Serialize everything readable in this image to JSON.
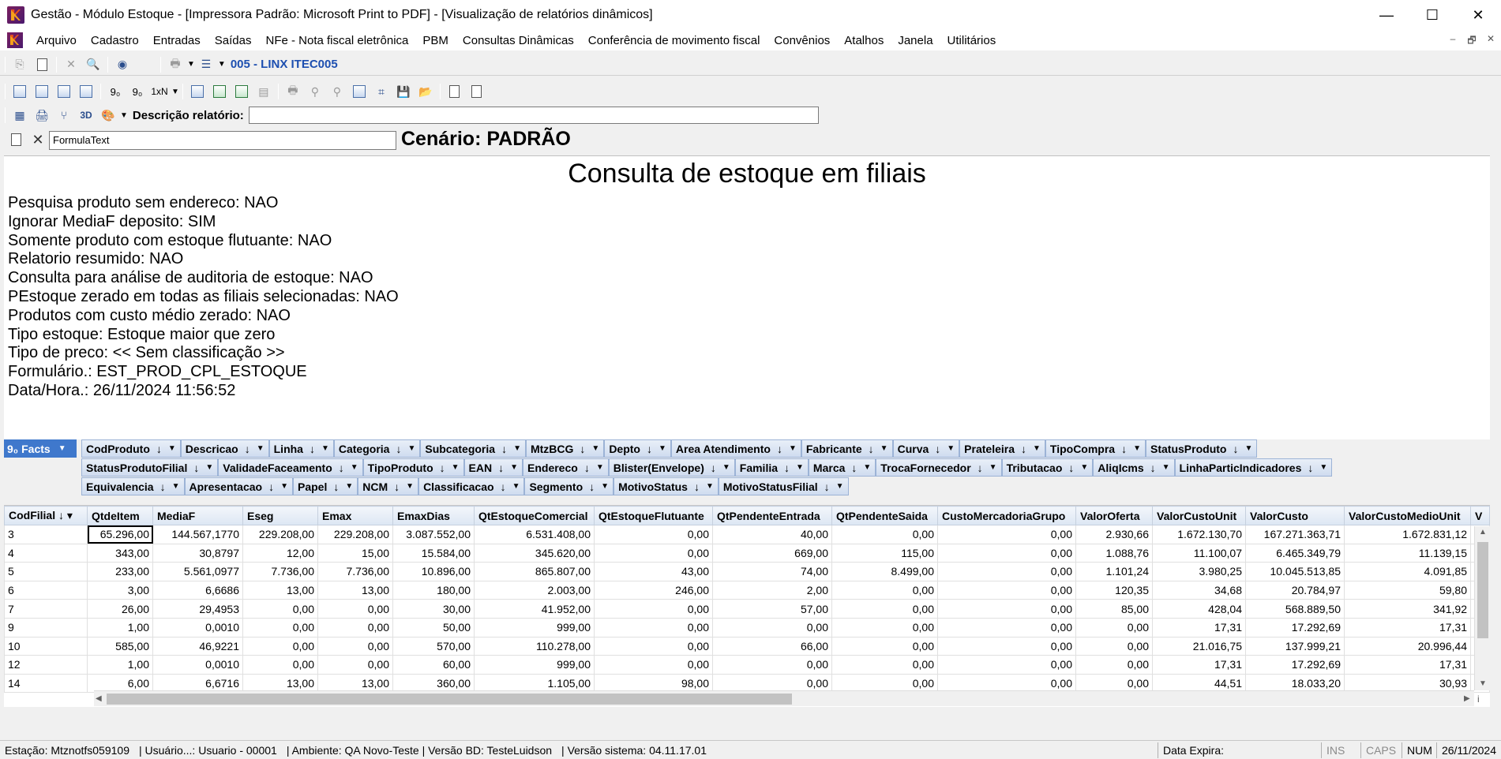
{
  "window": {
    "title": "Gestão  - Módulo Estoque - [Impressora Padrão: Microsoft Print to PDF] - [Visualização de relatórios dinâmicos]",
    "minimize": "—",
    "maximize": "☐",
    "close": "✕"
  },
  "menu": {
    "items": [
      "Arquivo",
      "Cadastro",
      "Entradas",
      "Saídas",
      "NFe - Nota fiscal eletrônica",
      "PBM",
      "Consultas Dinâmicas",
      "Conferência de movimento fiscal",
      "Convênios",
      "Atalhos",
      "Janela",
      "Utilitários"
    ],
    "mdi_min": "–",
    "mdi_restore": "🗗",
    "mdi_close": "✕"
  },
  "toolbar1": {
    "company": "005 - LINX ITEC005"
  },
  "toolbar2": {
    "labels": [
      "9₀",
      "9₀",
      "1xN"
    ]
  },
  "toolbar3": {
    "label_3d": "3D",
    "descricao_label": "Descrição relatório:",
    "descricao_value": ""
  },
  "formula": {
    "value": "FormulaText",
    "cenario": "Cenário: PADRÃO"
  },
  "report": {
    "title": "Consulta de estoque em filiais",
    "lines": [
      "Pesquisa produto sem endereco: NAO",
      "Ignorar MediaF deposito: SIM",
      "Somente produto com estoque flutuante: NAO",
      "Relatorio resumido: NAO",
      "Consulta para análise de auditoria de estoque: NAO",
      "PEstoque zerado em todas as filiais selecionadas: NAO",
      "Produtos com custo médio zerado: NAO",
      "Tipo estoque: Estoque maior que zero",
      "Tipo de preco: << Sem classificação >>",
      "Formulário.: EST_PROD_CPL_ESTOQUE",
      "Data/Hora.: 26/11/2024 11:56:52"
    ]
  },
  "pivot": {
    "facts_label": "Facts",
    "facts_prefix": "9₀",
    "row1": [
      "CodProduto",
      "Descricao",
      "Linha",
      "Categoria",
      "Subcategoria",
      "MtzBCG",
      "Depto",
      "Area Atendimento",
      "Fabricante",
      "Curva",
      "Prateleira",
      "TipoCompra",
      "StatusProduto"
    ],
    "row2": [
      "StatusProdutoFilial",
      "ValidadeFaceamento",
      "TipoProduto",
      "EAN",
      "Endereco",
      "Blister(Envelope)",
      "Familia",
      "Marca",
      "TrocaFornecedor",
      "Tributacao",
      "AliqIcms",
      "LinhaParticIndicadores"
    ],
    "row3": [
      "Equivalencia",
      "Apresentacao",
      "Papel",
      "NCM",
      "Classificacao",
      "Segmento",
      "MotivoStatus",
      "MotivoStatusFilial"
    ]
  },
  "grid": {
    "row_header": "CodFilial",
    "columns": [
      "QtdeItem",
      "MediaF",
      "Eseg",
      "Emax",
      "EmaxDias",
      "QtEstoqueComercial",
      "QtEstoqueFlutuante",
      "QtPendenteEntrada",
      "QtPendenteSaida",
      "CustoMercadoriaGrupo",
      "ValorOferta",
      "ValorCustoUnit",
      "ValorCusto",
      "ValorCustoMedioUnit",
      "V"
    ],
    "rows": [
      {
        "cod": "3",
        "vals": [
          "65.296,00",
          "144.567,1770",
          "229.208,00",
          "229.208,00",
          "3.087.552,00",
          "6.531.408,00",
          "0,00",
          "40,00",
          "0,00",
          "0,00",
          "2.930,66",
          "1.672.130,70",
          "167.271.363,71",
          "1.672.831,12"
        ]
      },
      {
        "cod": "4",
        "vals": [
          "343,00",
          "30,8797",
          "12,00",
          "15,00",
          "15.584,00",
          "345.620,00",
          "0,00",
          "669,00",
          "115,00",
          "0,00",
          "1.088,76",
          "11.100,07",
          "6.465.349,79",
          "11.139,15"
        ]
      },
      {
        "cod": "5",
        "vals": [
          "233,00",
          "5.561,0977",
          "7.736,00",
          "7.736,00",
          "10.896,00",
          "865.807,00",
          "43,00",
          "74,00",
          "8.499,00",
          "0,00",
          "1.101,24",
          "3.980,25",
          "10.045.513,85",
          "4.091,85"
        ]
      },
      {
        "cod": "6",
        "vals": [
          "3,00",
          "6,6686",
          "13,00",
          "13,00",
          "180,00",
          "2.003,00",
          "246,00",
          "2,00",
          "0,00",
          "0,00",
          "120,35",
          "34,68",
          "20.784,97",
          "59,80"
        ]
      },
      {
        "cod": "7",
        "vals": [
          "26,00",
          "29,4953",
          "0,00",
          "0,00",
          "30,00",
          "41.952,00",
          "0,00",
          "57,00",
          "0,00",
          "0,00",
          "85,00",
          "428,04",
          "568.889,50",
          "341,92"
        ]
      },
      {
        "cod": "9",
        "vals": [
          "1,00",
          "0,0010",
          "0,00",
          "0,00",
          "50,00",
          "999,00",
          "0,00",
          "0,00",
          "0,00",
          "0,00",
          "0,00",
          "17,31",
          "17.292,69",
          "17,31"
        ]
      },
      {
        "cod": "10",
        "vals": [
          "585,00",
          "46,9221",
          "0,00",
          "0,00",
          "570,00",
          "110.278,00",
          "0,00",
          "66,00",
          "0,00",
          "0,00",
          "0,00",
          "21.016,75",
          "137.999,21",
          "20.996,44"
        ]
      },
      {
        "cod": "12",
        "vals": [
          "1,00",
          "0,0010",
          "0,00",
          "0,00",
          "60,00",
          "999,00",
          "0,00",
          "0,00",
          "0,00",
          "0,00",
          "0,00",
          "17,31",
          "17.292,69",
          "17,31"
        ]
      },
      {
        "cod": "14",
        "vals": [
          "6,00",
          "6,6716",
          "13,00",
          "13,00",
          "360,00",
          "1.105,00",
          "98,00",
          "0,00",
          "0,00",
          "0,00",
          "0,00",
          "44,51",
          "18.033,20",
          "30,93"
        ]
      }
    ]
  },
  "status": {
    "estacao": "Estação: Mtznotfs059109",
    "usuario": "| Usuário...: Usuario - 00001",
    "ambiente": "| Ambiente: QA Novo-Teste | Versão BD: TesteLuidson",
    "versao": "| Versão sistema: 04.11.17.01",
    "data_expira": "Data Expira:",
    "ins": "INS",
    "caps": "CAPS",
    "num": "NUM",
    "date": "26/11/2024"
  }
}
